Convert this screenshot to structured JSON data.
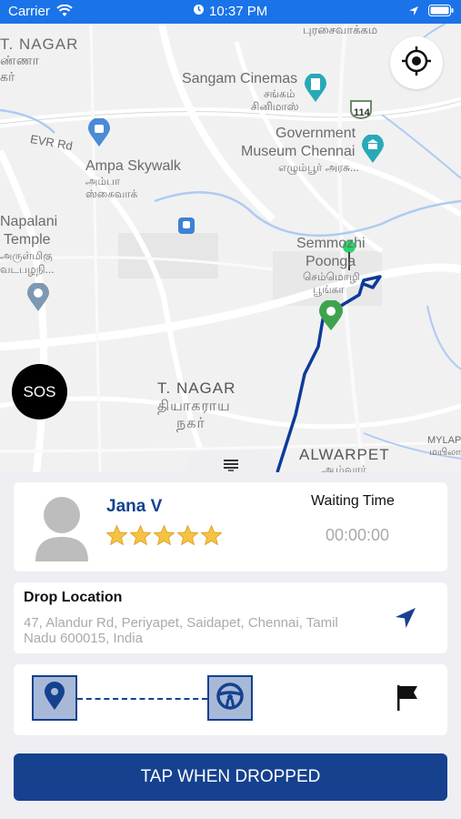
{
  "status_bar": {
    "carrier": "Carrier",
    "time": "10:37 PM"
  },
  "map": {
    "labels": {
      "t_nagar_top": "T. NAGAR",
      "t_nagar_top_ta1": "ண்ணா",
      "t_nagar_top_ta2": "கர்",
      "pursaivakkam_ta": "புரசைவாக்கம",
      "sangam": "Sangam Cinemas",
      "sangam_ta1": "சங்கம்",
      "sangam_ta2": "சினிமாஸ்",
      "route_114": "114",
      "evr_rd": "EVR Rd",
      "government": "Government",
      "museum": "Museum Chennai",
      "museum_ta": "எழும்பூர் அரசு...",
      "ampa": "Ampa Skywalk",
      "ampa_ta1": "அம்பா",
      "ampa_ta2": "ஸ்கைவாக்",
      "napalani": "Napalani",
      "temple": "Temple",
      "temple_ta1": "அருள்மிகு",
      "temple_ta2": "வடபழநி...",
      "semmozhi": "Semmozhi",
      "poonga": "Poonga",
      "poonga_ta1": "செம்மொழி",
      "poonga_ta2": "பூங்கா",
      "t_nagar": "T. NAGAR",
      "t_nagar_ta1": "தியாகராய",
      "t_nagar_ta2": "நகர்",
      "alwarpet": "ALWARPET",
      "alwarpet_ta": "ஆழ்வார்",
      "mylapore": "MYLAP",
      "mylapore_ta": "மயிலா"
    }
  },
  "sos_label": "SOS",
  "driver": {
    "name": "Jana V",
    "rating": 5,
    "waiting_label": "Waiting Time",
    "waiting_value": "00:00:00"
  },
  "drop": {
    "title": "Drop Location",
    "address": "47, Alandur Rd, Periyapet, Saidapet, Chennai, Tamil Nadu 600015, India"
  },
  "action": {
    "label": "TAP WHEN DROPPED"
  },
  "colors": {
    "primary": "#15418f",
    "status_bar": "#1a73e8",
    "star": "#f6c244",
    "route": "#0d3a9a"
  }
}
